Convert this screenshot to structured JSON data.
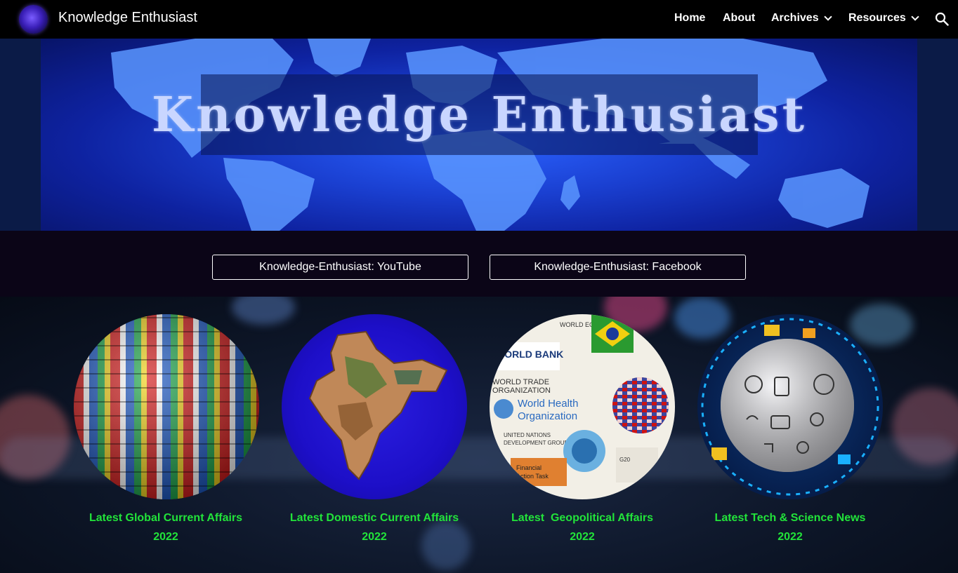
{
  "header": {
    "site_title": "Knowledge Enthusiast",
    "logo_icon": "globe-logo-icon",
    "nav": {
      "home": "Home",
      "about": "About",
      "archives": "Archives",
      "resources": "Resources"
    }
  },
  "hero": {
    "title": "Knowledge Enthusiast"
  },
  "social": {
    "youtube_label": "Knowledge-Enthusiast: YouTube",
    "facebook_label": "Knowledge-Enthusiast: Facebook"
  },
  "cards": [
    {
      "line1": "Latest Global Current Affairs",
      "line2": "2022",
      "image": "flag-globe"
    },
    {
      "line1": "Latest Domestic Current Affairs",
      "line2": "2022",
      "image": "india-map"
    },
    {
      "line1": "Latest  Geopolitical Affairs",
      "line2": "2022",
      "image": "world-organizations-collage"
    },
    {
      "line1": "Latest Tech & Science News",
      "line2": "2022",
      "image": "tech-sphere"
    }
  ],
  "colors": {
    "accent_green": "#22e33a",
    "nav_bg": "#000000",
    "hero_blue": "#1a3fd0"
  }
}
